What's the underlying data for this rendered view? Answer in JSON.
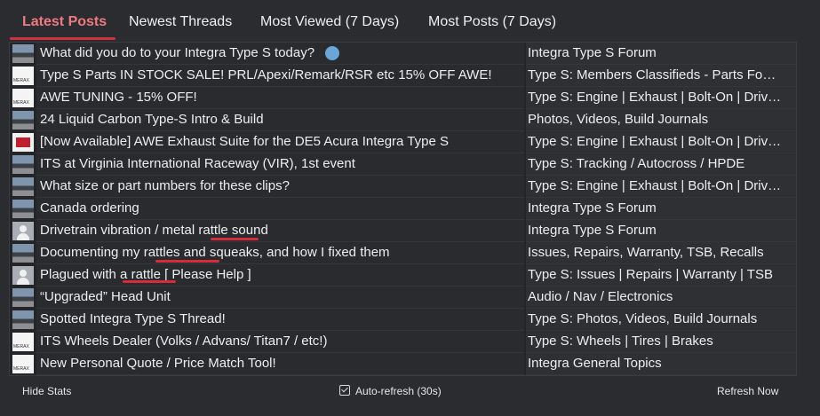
{
  "tabs": [
    {
      "label": "Latest Posts",
      "active": true
    },
    {
      "label": "Newest Threads"
    },
    {
      "label": "Most Viewed (7 Days)"
    },
    {
      "label": "Most Posts (7 Days)"
    }
  ],
  "rows": [
    {
      "title": "What did you do to your Integra Type S today?",
      "forum": "Integra Type S Forum",
      "thumb": "car-photo"
    },
    {
      "title": "Type S Parts IN STOCK SALE! PRL/Apexi/Remark/RSR etc 15% OFF AWE!",
      "forum": "Type S: Members Classifieds - Parts Fo…",
      "thumb": "merax-logo"
    },
    {
      "title": "AWE TUNING - 15% OFF!",
      "forum": "Type S: Engine | Exhaust | Bolt-On | Driv…",
      "thumb": "merax-logo"
    },
    {
      "title": "24 Liquid Carbon Type-S Intro & Build",
      "forum": "Photos, Videos, Build Journals",
      "thumb": "car-photo"
    },
    {
      "title": "[Now Available] AWE Exhaust Suite for the DE5 Acura Integra Type S",
      "forum": "Type S: Engine | Exhaust | Bolt-On | Driv…",
      "thumb": "awe-logo"
    },
    {
      "title": "ITS at Virginia International Raceway (VIR), 1st event",
      "forum": "Type S: Tracking / Autocross / HPDE",
      "thumb": "car-photo"
    },
    {
      "title": "What size or part numbers for these clips?",
      "forum": "Type S: Engine | Exhaust | Bolt-On | Driv…",
      "thumb": "car-photo"
    },
    {
      "title": "Canada ordering",
      "forum": "Integra Type S Forum",
      "thumb": "car-photo"
    },
    {
      "title": "Drivetrain vibration / metal rattle sound",
      "forum": "Integra Type S Forum",
      "thumb": "default-avatar"
    },
    {
      "title": "Documenting my rattles and squeaks, and how I fixed them",
      "forum": "Issues, Repairs, Warranty, TSB, Recalls",
      "thumb": "car-photo"
    },
    {
      "title": "Plagued with a rattle [ Please Help ]",
      "forum": "Type S: Issues | Repairs | Warranty | TSB",
      "thumb": "default-avatar"
    },
    {
      "title": "“Upgraded” Head Unit",
      "forum": "Audio / Nav / Electronics",
      "thumb": "car-photo"
    },
    {
      "title": "Spotted Integra Type S Thread!",
      "forum": "Type S: Photos, Videos, Build Journals",
      "thumb": "car-photo"
    },
    {
      "title": "ITS Wheels Dealer (Volks / Advans/ Titan7 / etc!)",
      "forum": "Type S: Wheels | Tires | Brakes",
      "thumb": "merax-logo"
    },
    {
      "title": "New Personal Quote / Price Match Tool!",
      "forum": "Integra General Topics",
      "thumb": "merax-logo"
    }
  ],
  "footer": {
    "hide_stats": "Hide Stats",
    "auto_refresh": "Auto-refresh (30s)",
    "auto_refresh_checked": true,
    "refresh_now": "Refresh Now"
  },
  "colors": {
    "background": "#2b2c30",
    "active_tab": "#f07a82",
    "accent_underline": "#d0313f",
    "annotation_underline": "#d62b3b"
  }
}
